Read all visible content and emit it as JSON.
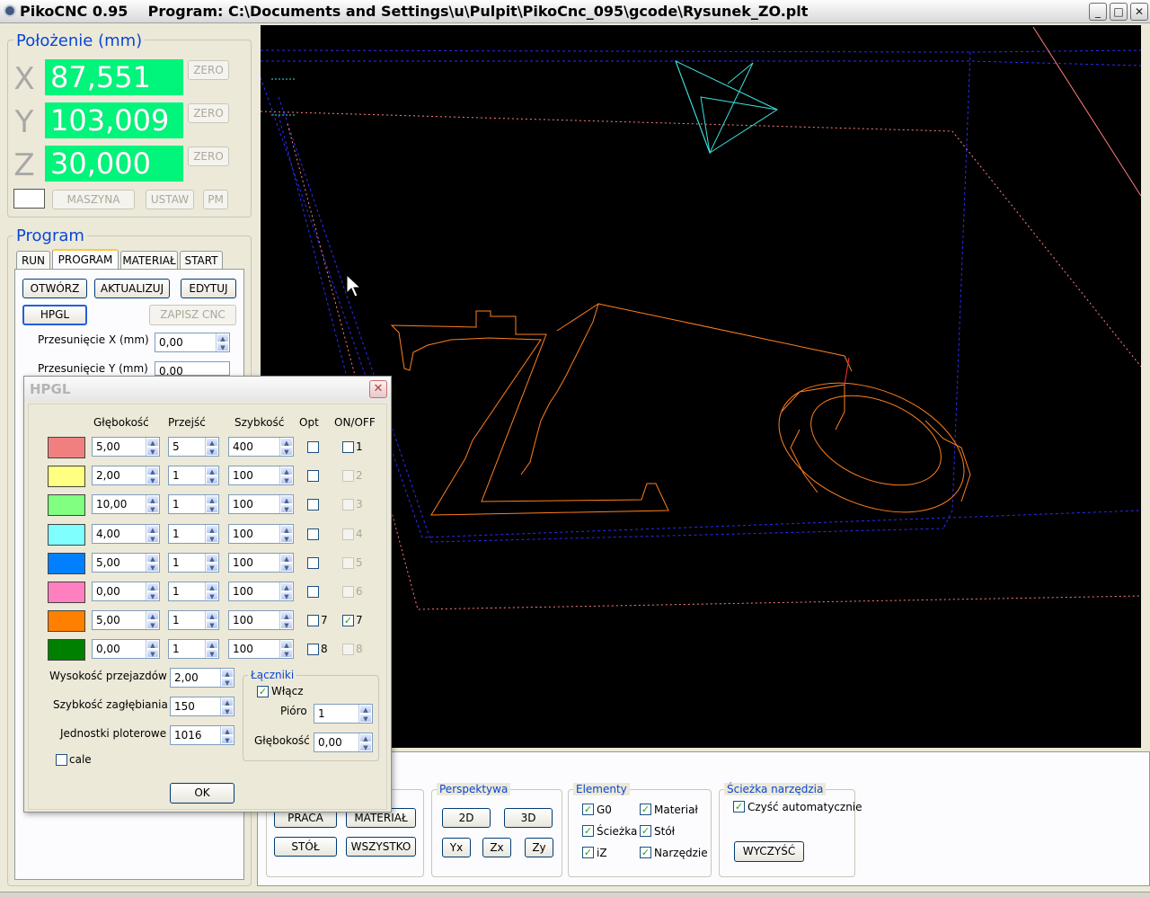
{
  "window": {
    "app_title": "PikoCNC 0.95",
    "program_label": "Program:",
    "program_path": "C:\\Documents and Settings\\u\\Pulpit\\PikoCnc_095\\gcode\\Rysunek_ZO.plt",
    "minimize": "_",
    "maximize": "□",
    "close": "✕"
  },
  "position": {
    "title": "Położenie (mm)",
    "axes": [
      {
        "label": "X",
        "value": "87,551",
        "zero": "ZERO"
      },
      {
        "label": "Y",
        "value": "103,009",
        "zero": "ZERO"
      },
      {
        "label": "Z",
        "value": "30,000",
        "zero": "ZERO"
      }
    ],
    "maszyna": "MASZYNA",
    "ustaw": "USTAW",
    "pm": "PM"
  },
  "program": {
    "title": "Program",
    "tabs": [
      "RUN",
      "PROGRAM",
      "MATERIAŁ",
      "START"
    ],
    "active_tab": "PROGRAM",
    "otworz": "OTWÓRZ",
    "aktualizuj": "AKTUALIZUJ",
    "edytuj": "EDYTUJ",
    "hpgl": "HPGL",
    "zapisz_cnc": "ZAPISZ CNC",
    "offset_x_label": "Przesunięcie X (mm)",
    "offset_x_value": "0,00",
    "offset_y_label": "Przesunięcie Y (mm)",
    "offset_y_value": "0,00"
  },
  "hpgl": {
    "title": "HPGL",
    "close": "✕",
    "headers": {
      "depth": "Głębokość",
      "passes": "Przejść",
      "speed": "Szybkość",
      "opt": "Opt",
      "onoff": "ON/OFF"
    },
    "rows": [
      {
        "color": "#f08080",
        "depth": "5,00",
        "passes": "5",
        "speed": "400",
        "opt": "",
        "opt_checked": false,
        "on": "1",
        "on_checked": false,
        "on_enabled": true
      },
      {
        "color": "#ffff80",
        "depth": "2,00",
        "passes": "1",
        "speed": "100",
        "opt": "",
        "opt_checked": false,
        "on": "2",
        "on_checked": false,
        "on_enabled": false
      },
      {
        "color": "#80ff80",
        "depth": "10,00",
        "passes": "1",
        "speed": "100",
        "opt": "",
        "opt_checked": false,
        "on": "3",
        "on_checked": false,
        "on_enabled": false
      },
      {
        "color": "#80ffff",
        "depth": "4,00",
        "passes": "1",
        "speed": "100",
        "opt": "",
        "opt_checked": false,
        "on": "4",
        "on_checked": false,
        "on_enabled": false
      },
      {
        "color": "#0080ff",
        "depth": "5,00",
        "passes": "1",
        "speed": "100",
        "opt": "",
        "opt_checked": false,
        "on": "5",
        "on_checked": false,
        "on_enabled": false
      },
      {
        "color": "#ff80c0",
        "depth": "0,00",
        "passes": "1",
        "speed": "100",
        "opt": "",
        "opt_checked": false,
        "on": "6",
        "on_checked": false,
        "on_enabled": false
      },
      {
        "color": "#ff8000",
        "depth": "5,00",
        "passes": "1",
        "speed": "100",
        "opt": "7",
        "opt_checked": false,
        "on": "7",
        "on_checked": true,
        "on_enabled": true
      },
      {
        "color": "#008000",
        "depth": "0,00",
        "passes": "1",
        "speed": "100",
        "opt": "8",
        "opt_checked": false,
        "on": "8",
        "on_checked": false,
        "on_enabled": false
      }
    ],
    "travel_height_label": "Wysokość przejazdów",
    "travel_height": "2,00",
    "plunge_speed_label": "Szybkość zagłębiania",
    "plunge_speed": "150",
    "plotter_units_label": "Jednostki ploterowe",
    "plotter_units": "1016",
    "inches_label": "cale",
    "inches_checked": false,
    "tabs_group_title": "Łączniki",
    "enable_label": "Włącz",
    "enable_checked": true,
    "pen_label": "Pióro",
    "pen_value": "1",
    "tabs_depth_label": "Głębokość",
    "tabs_depth_value": "0,00",
    "ok": "OK"
  },
  "bottom": {
    "view_buttons": {
      "praca": "PRACA",
      "material": "MATERIAŁ",
      "stol": "STÓŁ",
      "wszystko": "WSZYSTKO"
    },
    "perspective": {
      "title": "Perspektywa",
      "b2d": "2D",
      "b3d": "3D",
      "yx": "Yx",
      "zx": "Zx",
      "zy": "Zy"
    },
    "elements": {
      "title": "Elementy",
      "items": [
        {
          "label": "G0",
          "checked": true
        },
        {
          "label": "Materiał",
          "checked": true
        },
        {
          "label": "Ścieżka",
          "checked": true
        },
        {
          "label": "Stół",
          "checked": true
        },
        {
          "label": "iZ",
          "checked": true
        },
        {
          "label": "Narzędzie",
          "checked": true
        }
      ]
    },
    "toolpath": {
      "title": "Ścieżka narzędzia",
      "auto_clear": "Czyść automatycznie",
      "auto_clear_checked": true,
      "clear": "WYCZYŚĆ"
    }
  },
  "colors": {
    "pos_bg": "#00f57a",
    "accent": "#0a46d6",
    "canvas_bg": "#000000",
    "path_orange": "#ff7f1e",
    "table_blue": "#2b2bff",
    "material_pink": "#ff8080",
    "tool_cyan": "#3ce0e0"
  }
}
